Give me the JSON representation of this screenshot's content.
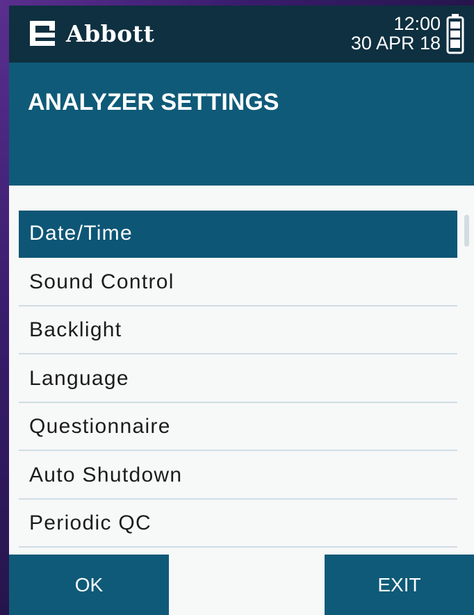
{
  "header": {
    "brand": "Abbott",
    "time": "12:00",
    "date": "30 APR 18",
    "brand_logo_icon": "abbott-logo-icon",
    "battery_icon": "battery-icon"
  },
  "title": "ANALYZER SETTINGS",
  "menu": {
    "items": [
      {
        "label": "Date/Time",
        "selected": true
      },
      {
        "label": "Sound Control",
        "selected": false
      },
      {
        "label": "Backlight",
        "selected": false
      },
      {
        "label": "Language",
        "selected": false
      },
      {
        "label": "Questionnaire",
        "selected": false
      },
      {
        "label": "Auto Shutdown",
        "selected": false
      },
      {
        "label": "Periodic QC",
        "selected": false
      }
    ]
  },
  "buttons": {
    "ok": "OK",
    "exit": "EXIT"
  },
  "colors": {
    "status_bar": "#0e3040",
    "title_band": "#0f5a78",
    "selected_row": "#0d5676",
    "background": "#f7f8f8"
  }
}
